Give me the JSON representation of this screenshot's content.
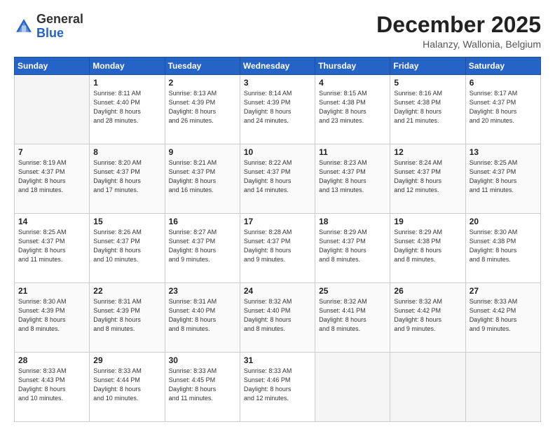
{
  "header": {
    "logo_general": "General",
    "logo_blue": "Blue",
    "month": "December 2025",
    "location": "Halanzy, Wallonia, Belgium"
  },
  "calendar": {
    "days_of_week": [
      "Sunday",
      "Monday",
      "Tuesday",
      "Wednesday",
      "Thursday",
      "Friday",
      "Saturday"
    ],
    "weeks": [
      [
        {
          "day": "",
          "info": ""
        },
        {
          "day": "1",
          "info": "Sunrise: 8:11 AM\nSunset: 4:40 PM\nDaylight: 8 hours\nand 28 minutes."
        },
        {
          "day": "2",
          "info": "Sunrise: 8:13 AM\nSunset: 4:39 PM\nDaylight: 8 hours\nand 26 minutes."
        },
        {
          "day": "3",
          "info": "Sunrise: 8:14 AM\nSunset: 4:39 PM\nDaylight: 8 hours\nand 24 minutes."
        },
        {
          "day": "4",
          "info": "Sunrise: 8:15 AM\nSunset: 4:38 PM\nDaylight: 8 hours\nand 23 minutes."
        },
        {
          "day": "5",
          "info": "Sunrise: 8:16 AM\nSunset: 4:38 PM\nDaylight: 8 hours\nand 21 minutes."
        },
        {
          "day": "6",
          "info": "Sunrise: 8:17 AM\nSunset: 4:37 PM\nDaylight: 8 hours\nand 20 minutes."
        }
      ],
      [
        {
          "day": "7",
          "info": "Sunrise: 8:19 AM\nSunset: 4:37 PM\nDaylight: 8 hours\nand 18 minutes."
        },
        {
          "day": "8",
          "info": "Sunrise: 8:20 AM\nSunset: 4:37 PM\nDaylight: 8 hours\nand 17 minutes."
        },
        {
          "day": "9",
          "info": "Sunrise: 8:21 AM\nSunset: 4:37 PM\nDaylight: 8 hours\nand 16 minutes."
        },
        {
          "day": "10",
          "info": "Sunrise: 8:22 AM\nSunset: 4:37 PM\nDaylight: 8 hours\nand 14 minutes."
        },
        {
          "day": "11",
          "info": "Sunrise: 8:23 AM\nSunset: 4:37 PM\nDaylight: 8 hours\nand 13 minutes."
        },
        {
          "day": "12",
          "info": "Sunrise: 8:24 AM\nSunset: 4:37 PM\nDaylight: 8 hours\nand 12 minutes."
        },
        {
          "day": "13",
          "info": "Sunrise: 8:25 AM\nSunset: 4:37 PM\nDaylight: 8 hours\nand 11 minutes."
        }
      ],
      [
        {
          "day": "14",
          "info": "Sunrise: 8:25 AM\nSunset: 4:37 PM\nDaylight: 8 hours\nand 11 minutes."
        },
        {
          "day": "15",
          "info": "Sunrise: 8:26 AM\nSunset: 4:37 PM\nDaylight: 8 hours\nand 10 minutes."
        },
        {
          "day": "16",
          "info": "Sunrise: 8:27 AM\nSunset: 4:37 PM\nDaylight: 8 hours\nand 9 minutes."
        },
        {
          "day": "17",
          "info": "Sunrise: 8:28 AM\nSunset: 4:37 PM\nDaylight: 8 hours\nand 9 minutes."
        },
        {
          "day": "18",
          "info": "Sunrise: 8:29 AM\nSunset: 4:37 PM\nDaylight: 8 hours\nand 8 minutes."
        },
        {
          "day": "19",
          "info": "Sunrise: 8:29 AM\nSunset: 4:38 PM\nDaylight: 8 hours\nand 8 minutes."
        },
        {
          "day": "20",
          "info": "Sunrise: 8:30 AM\nSunset: 4:38 PM\nDaylight: 8 hours\nand 8 minutes."
        }
      ],
      [
        {
          "day": "21",
          "info": "Sunrise: 8:30 AM\nSunset: 4:39 PM\nDaylight: 8 hours\nand 8 minutes."
        },
        {
          "day": "22",
          "info": "Sunrise: 8:31 AM\nSunset: 4:39 PM\nDaylight: 8 hours\nand 8 minutes."
        },
        {
          "day": "23",
          "info": "Sunrise: 8:31 AM\nSunset: 4:40 PM\nDaylight: 8 hours\nand 8 minutes."
        },
        {
          "day": "24",
          "info": "Sunrise: 8:32 AM\nSunset: 4:40 PM\nDaylight: 8 hours\nand 8 minutes."
        },
        {
          "day": "25",
          "info": "Sunrise: 8:32 AM\nSunset: 4:41 PM\nDaylight: 8 hours\nand 8 minutes."
        },
        {
          "day": "26",
          "info": "Sunrise: 8:32 AM\nSunset: 4:42 PM\nDaylight: 8 hours\nand 9 minutes."
        },
        {
          "day": "27",
          "info": "Sunrise: 8:33 AM\nSunset: 4:42 PM\nDaylight: 8 hours\nand 9 minutes."
        }
      ],
      [
        {
          "day": "28",
          "info": "Sunrise: 8:33 AM\nSunset: 4:43 PM\nDaylight: 8 hours\nand 10 minutes."
        },
        {
          "day": "29",
          "info": "Sunrise: 8:33 AM\nSunset: 4:44 PM\nDaylight: 8 hours\nand 10 minutes."
        },
        {
          "day": "30",
          "info": "Sunrise: 8:33 AM\nSunset: 4:45 PM\nDaylight: 8 hours\nand 11 minutes."
        },
        {
          "day": "31",
          "info": "Sunrise: 8:33 AM\nSunset: 4:46 PM\nDaylight: 8 hours\nand 12 minutes."
        },
        {
          "day": "",
          "info": ""
        },
        {
          "day": "",
          "info": ""
        },
        {
          "day": "",
          "info": ""
        }
      ]
    ]
  }
}
